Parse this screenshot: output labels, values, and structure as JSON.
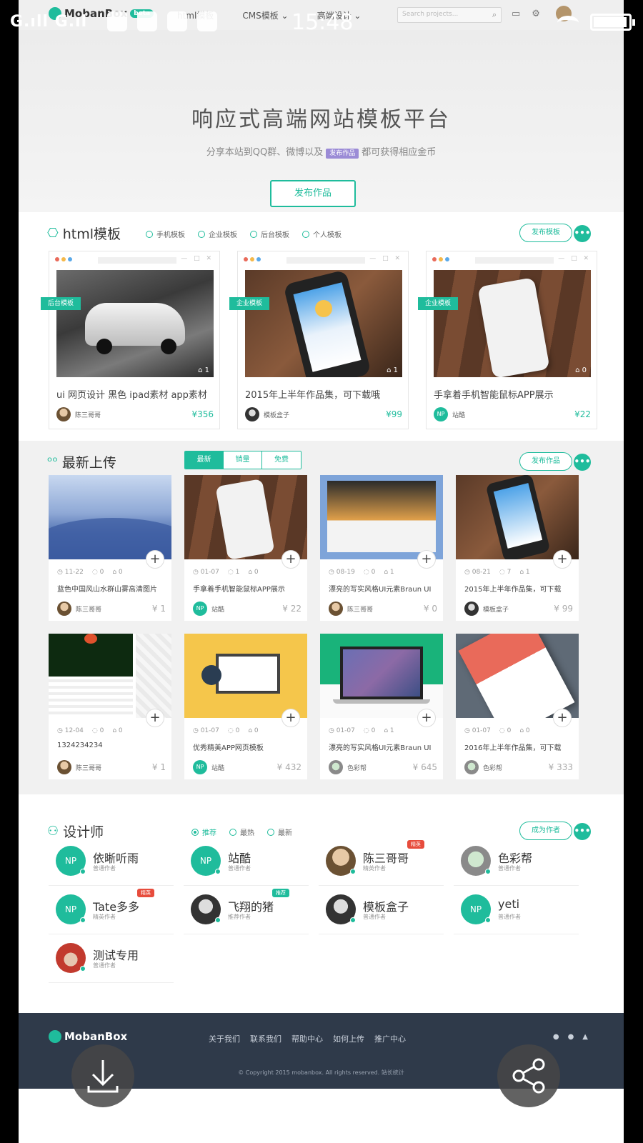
{
  "status": {
    "carrier": "G.ıll G.ıl",
    "time": "15:48"
  },
  "nav": {
    "logo": "MobanBox",
    "badge": "beta",
    "menu": [
      "html模板",
      "CMS模板",
      "高端设计"
    ],
    "search_placeholder": "Search projects..."
  },
  "hero": {
    "title": "响应式高端网站模板平台",
    "sub_pre": "分享本站到QQ群、微博以及",
    "sub_hl": "发布作品",
    "sub_post": "都可获得相应金币",
    "button": "发布作品"
  },
  "html_section": {
    "title": "html模板",
    "filters": [
      "手机模板",
      "企业模板",
      "后台模板",
      "个人模板"
    ],
    "action": "发布模板",
    "more": "•••",
    "cards": [
      {
        "ribbon": "后台模板",
        "likes": "1",
        "name": "ui 网页设计 黑色 ipad素材 app素材",
        "author": "陈三哥哥",
        "price": "¥356"
      },
      {
        "ribbon": "企业模板",
        "likes": "1",
        "name": "2015年上半年作品集，可下载哦",
        "author": "模板盒子",
        "price": "¥99"
      },
      {
        "ribbon": "企业模板",
        "likes": "0",
        "name": "手拿着手机智能鼠标APP展示",
        "author": "站酷",
        "price": "¥22"
      }
    ]
  },
  "new_section": {
    "title": "最新上传",
    "tabs": [
      "最新",
      "销量",
      "免费"
    ],
    "action": "发布作品",
    "more": "•••",
    "items": [
      {
        "date": "11-22",
        "comments": "0",
        "likes": "0",
        "name": "蓝色中国风山水群山雾高清图片",
        "author": "陈三哥哥",
        "price": "¥ 1"
      },
      {
        "date": "01-07",
        "comments": "1",
        "likes": "0",
        "name": "手拿着手机智能鼠标APP展示",
        "author": "站酷",
        "price": "¥ 22"
      },
      {
        "date": "08-19",
        "comments": "0",
        "likes": "1",
        "name": "漂亮的写实风格UI元素Braun UI",
        "author": "陈三哥哥",
        "price": "¥ 0"
      },
      {
        "date": "08-21",
        "comments": "7",
        "likes": "1",
        "name": "2015年上半年作品集，可下载",
        "author": "模板盒子",
        "price": "¥ 99"
      },
      {
        "date": "12-04",
        "comments": "0",
        "likes": "0",
        "name": "1324234234",
        "author": "陈三哥哥",
        "price": "¥ 1"
      },
      {
        "date": "01-07",
        "comments": "0",
        "likes": "0",
        "name": "优秀精美APP网页模板",
        "author": "站酷",
        "price": "¥ 432"
      },
      {
        "date": "01-07",
        "comments": "0",
        "likes": "1",
        "name": "漂亮的写实风格UI元素Braun UI",
        "author": "色彩帮",
        "price": "¥ 645"
      },
      {
        "date": "01-07",
        "comments": "0",
        "likes": "0",
        "name": "2016年上半年作品集，可下载",
        "author": "色彩帮",
        "price": "¥ 333"
      }
    ]
  },
  "designers": {
    "title": "设计师",
    "filters": [
      "推荐",
      "最热",
      "最新"
    ],
    "action": "成为作者",
    "more": "•••",
    "list": [
      {
        "name": "依晰听雨",
        "role": "普通作者",
        "tag": ""
      },
      {
        "name": "站酷",
        "role": "普通作者",
        "tag": ""
      },
      {
        "name": "陈三哥哥",
        "role": "精英作者",
        "tag": "精英"
      },
      {
        "name": "色彩帮",
        "role": "普通作者",
        "tag": ""
      },
      {
        "name": "Tate多多",
        "role": "精英作者",
        "tag": "精英"
      },
      {
        "name": "飞翔的猪",
        "role": "推荐作者",
        "tag": "推荐"
      },
      {
        "name": "模板盒子",
        "role": "普通作者",
        "tag": ""
      },
      {
        "name": "yeti",
        "role": "普通作者",
        "tag": ""
      },
      {
        "name": "测试专用",
        "role": "普通作者",
        "tag": ""
      }
    ],
    "np": "NP"
  },
  "footer": {
    "logo": "MobanBox",
    "links": [
      "关于我们",
      "联系我们",
      "帮助中心",
      "如何上传",
      "推广中心"
    ],
    "copyright": "© Copyright 2015 mobanbox. All rights reserved.  站长统计"
  },
  "colors": {
    "accent": "#1fbc9c",
    "footer_bg": "#2f3a4a"
  }
}
